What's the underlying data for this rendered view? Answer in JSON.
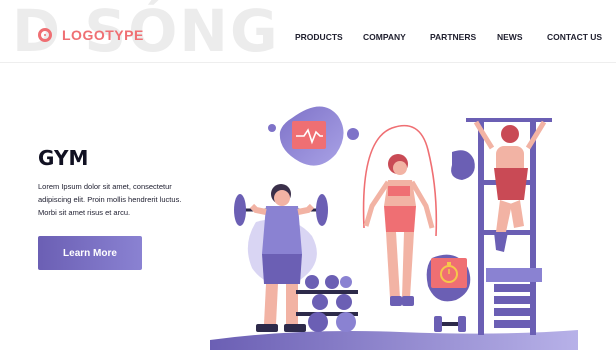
{
  "watermark": "D SÓNG",
  "header": {
    "logo_text": "LOGOTYPE",
    "nav": [
      "PRODUCTS",
      "COMPANY",
      "PARTNERS",
      "NEWS",
      "CONTACT US"
    ]
  },
  "hero": {
    "title": "GYM",
    "description_lines": [
      "Lorem Ipsum dolor sit amet, consectetur",
      "adipiscing elit. Proin mollis hendrerit luctus.",
      "Morbi sit amet risus et arcu."
    ],
    "button_label": "Learn More"
  },
  "illustration": {
    "icons": [
      "heart-rate-icon",
      "stopwatch-icon"
    ],
    "colors": {
      "accent": "#ef6f73",
      "purple": "#6b5fb4",
      "lavender": "#8a82d2",
      "skin": "#f2b3a4"
    }
  }
}
